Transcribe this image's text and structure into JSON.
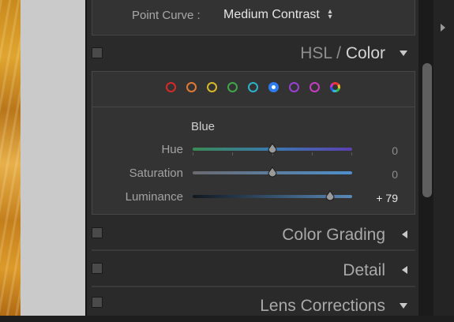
{
  "tone_curve": {
    "point_curve_label": "Point Curve :",
    "point_curve_value": "Medium Contrast",
    "point_curve_arrows": "⌃⌄"
  },
  "hsl_panel": {
    "title_hsl": "HSL",
    "title_slash": "/",
    "title_color": "Color",
    "toggle_icon": "triangle-down-icon",
    "swatches": [
      {
        "name": "red",
        "color": "#d62a2a",
        "selected": false
      },
      {
        "name": "orange",
        "color": "#e07a33",
        "selected": false
      },
      {
        "name": "yellow",
        "color": "#d9b827",
        "selected": false
      },
      {
        "name": "green",
        "color": "#3fa64a",
        "selected": false
      },
      {
        "name": "aqua",
        "color": "#2bb3c9",
        "selected": false
      },
      {
        "name": "blue",
        "color": "#2d7cf0",
        "selected": true
      },
      {
        "name": "purple",
        "color": "#9b3fd6",
        "selected": false
      },
      {
        "name": "magenta",
        "color": "#c63cc4",
        "selected": false
      },
      {
        "name": "all",
        "color": "multi",
        "selected": false
      }
    ],
    "band_title": "Blue",
    "sliders": [
      {
        "label": "Hue",
        "value": "0",
        "position": 0.5
      },
      {
        "label": "Saturation",
        "value": "0",
        "position": 0.5
      },
      {
        "label": "Luminance",
        "value": "+ 79",
        "position": 0.865
      }
    ]
  },
  "sections": [
    {
      "title": "Color Grading",
      "state": "collapsed"
    },
    {
      "title": "Detail",
      "state": "collapsed"
    },
    {
      "title": "Lens Corrections",
      "state": "expanded"
    }
  ]
}
